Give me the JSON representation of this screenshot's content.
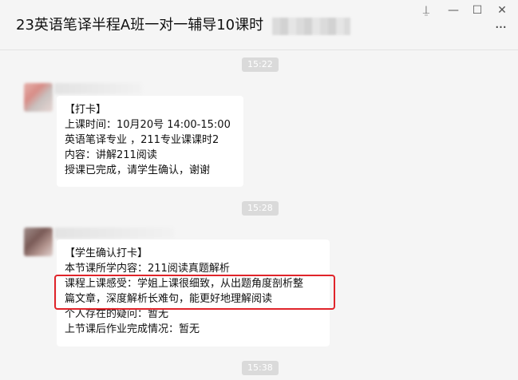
{
  "header": {
    "title": "23英语笔译半程A班一对一辅导10课时",
    "window_controls": {
      "pin": "⍊",
      "minimize": "—",
      "maximize": "☐",
      "close": "✕"
    },
    "more": "···"
  },
  "messages": [
    {
      "time": "15:22",
      "lines": [
        "【打卡】",
        "上课时间：10月20号  14:00-15:00",
        "英语笔译专业 ，211专业课课时2",
        "内容：讲解211阅读",
        "授课已完成，请学生确认，谢谢"
      ]
    },
    {
      "time": "15:28",
      "lines": [
        "【学生确认打卡】",
        "本节课所学内容：211阅读真题解析",
        "课程上课感受：学姐上课很细致，从出题角度剖析整",
        "篇文章，深度解析长难句，能更好地理解阅读",
        "个人存在的疑问：暂无",
        "上节课后作业完成情况：暂无"
      ]
    }
  ],
  "bottom_time": "15:38",
  "colors": {
    "background": "#f5f5f5",
    "bubble": "#ffffff",
    "timestamp_bg": "#dadada",
    "highlight": "#e0242a"
  }
}
